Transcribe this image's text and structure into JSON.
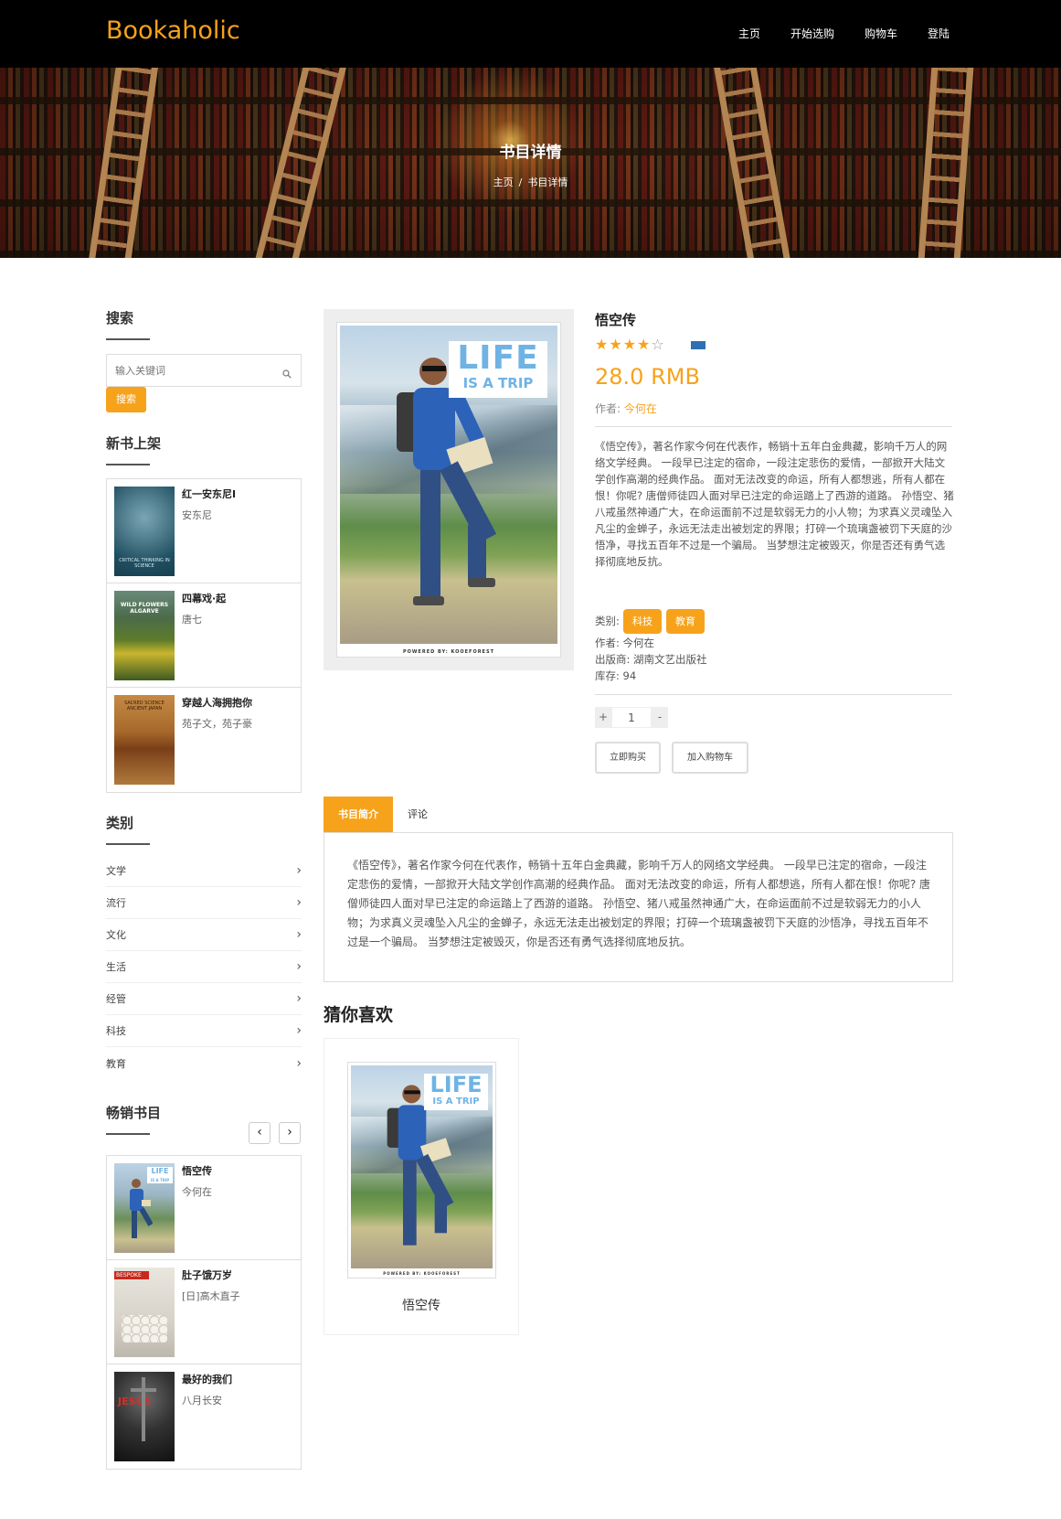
{
  "nav": {
    "logo": "Bookaholic",
    "links": [
      "主页",
      "开始选购",
      "购物车",
      "登陆"
    ]
  },
  "banner": {
    "title": "书目详情",
    "breadcrumb": [
      "主页",
      "/",
      "书目详情"
    ]
  },
  "sidebar": {
    "search": {
      "title": "搜索",
      "placeholder": "输入关键词",
      "button": "搜索"
    },
    "new_books": {
      "title": "新书上架",
      "items": [
        {
          "name": "红一安东尼I",
          "author": "安东尼",
          "cover_text": "CRITICAL THINKING IN SCIENCE"
        },
        {
          "name": "四幕戏·起",
          "author": "唐七",
          "cover_text": "WILD FLOWERS ALGARVE"
        },
        {
          "name": "穿越人海拥抱你",
          "author": "苑子文，苑子豪",
          "cover_text": "SACRED SCIENCE ANCIENT JAPAN"
        }
      ]
    },
    "categories": {
      "title": "类别",
      "items": [
        "文学",
        "流行",
        "文化",
        "生活",
        "经管",
        "科技",
        "教育"
      ]
    },
    "bestsellers": {
      "title": "畅销书目",
      "items": [
        {
          "name": "悟空传",
          "author": "今何在"
        },
        {
          "name": "肚子饿万岁",
          "author": "[日]高木直子",
          "cover_text": "BESPOKE"
        },
        {
          "name": "最好的我们",
          "author": "八月长安",
          "cover_text": "JESUS"
        }
      ]
    }
  },
  "product": {
    "title": "悟空传",
    "rating": 4,
    "rating_max": 5,
    "price": "28.0 RMB",
    "author_label": "作者:",
    "author": "今何在",
    "cover": {
      "line1": "LIFE",
      "line2": "IS A TRIP",
      "footer": "POWERED BY: KOOEFOREST"
    },
    "description": "《悟空传》，著名作家今何在代表作，畅销十五年白金典藏，影响千万人的网络文学经典。 一段早已注定的宿命，一段注定悲伤的爱情，一部掀开大陆文学创作高潮的经典作品。 面对无法改变的命运，所有人都想逃，所有人都在恨！你呢? 唐僧师徒四人面对早已注定的命运踏上了西游的道路。 孙悟空、猪八戒虽然神通广大，在命运面前不过是软弱无力的小人物；为求真义灵魂坠入凡尘的金蝉子，永远无法走出被划定的界限；打碎一个琉璃盏被罚下天庭的沙悟净，寻找五百年不过是一个骗局。 当梦想注定被毁灭，你是否还有勇气选择彻底地反抗。",
    "category_label": "类别:",
    "category_tags": [
      "科技",
      "教育"
    ],
    "meta_author": "作者: 今何在",
    "publisher": "出版商: 湖南文艺出版社",
    "stock": "库存: 94",
    "qty_plus": "+",
    "qty_value": "1",
    "qty_minus": "-",
    "buy_now": "立即购买",
    "add_cart": "加入购物车"
  },
  "tabs": {
    "items": [
      "书目简介",
      "评论"
    ],
    "active": 0,
    "content": "《悟空传》，著名作家今何在代表作，畅销十五年白金典藏，影响千万人的网络文学经典。 一段早已注定的宿命，一段注定悲伤的爱情，一部掀开大陆文学创作高潮的经典作品。 面对无法改变的命运，所有人都想逃，所有人都在恨！你呢? 唐僧师徒四人面对早已注定的命运踏上了西游的道路。 孙悟空、猪八戒虽然神通广大，在命运面前不过是软弱无力的小人物；为求真义灵魂坠入凡尘的金蝉子，永远无法走出被划定的界限；打碎一个琉璃盏被罚下天庭的沙悟净，寻找五百年不过是一个骗局。 当梦想注定被毁灭，你是否还有勇气选择彻底地反抗。"
  },
  "recommend": {
    "title": "猜你喜欢",
    "items": [
      {
        "name": "悟空传"
      }
    ]
  },
  "colors": {
    "accent": "#f7a21b",
    "nav_bg": "#000000"
  }
}
